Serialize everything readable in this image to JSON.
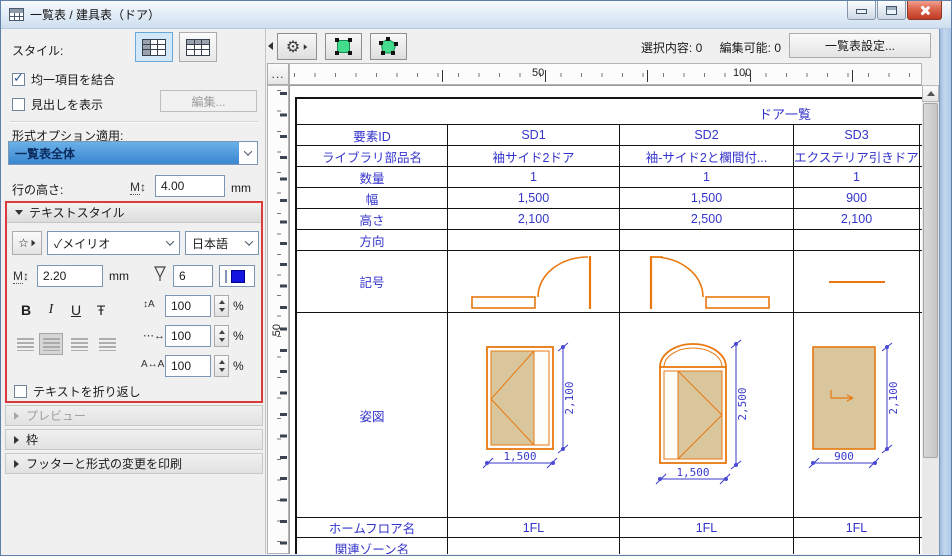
{
  "window": {
    "title": "一覧表 / 建具表（ドア）"
  },
  "colors": {
    "table_text_blue": "#3434CC",
    "drawing_orange": "#E8780F",
    "door_fill_tan": "#D9C69C",
    "dimension_blue": "#3A3ACC",
    "highlight_red": "#DC3A3A",
    "pen_color_swatch": "#1414E0",
    "selection_green": "#42DC8C"
  },
  "sidebar": {
    "style_label": "スタイル:",
    "merge_checkbox_label": "均一項目を結合",
    "headline_checkbox_label": "見出しを表示",
    "edit_button_label": "編集...",
    "format_option_label": "形式オプション適用:",
    "format_option_value": "一覧表全体",
    "row_height_label": "行の高さ:",
    "row_height_icon": "M",
    "row_height_value": "4.00",
    "row_height_unit": "mm",
    "text_style": {
      "header": "テキストスタイル",
      "font_check": "✓",
      "font_name": "メイリオ",
      "language": "日本語",
      "size_icon": "M",
      "size_value": "2.20",
      "size_unit": "mm",
      "pen_value": "6",
      "bold_label": "B",
      "italic_label": "I",
      "underline_label": "U",
      "strike_label": "Ŧ",
      "line_spacing_value": "100",
      "width_factor_value": "100",
      "char_spacing_value": "100",
      "percent": "%",
      "wrap_checkbox_label": "テキストを折り返し"
    },
    "sections": [
      {
        "label": "プレビュー"
      },
      {
        "label": "枠"
      },
      {
        "label": "フッターと形式の変更を印刷"
      }
    ]
  },
  "toolbar": {
    "selection_label": "選択内容:",
    "selection_count": "0",
    "editable_label": "編集可能:",
    "editable_count": "0",
    "settings_button": "一覧表設定..."
  },
  "ruler": {
    "corner_label": "...",
    "h_label_50": "50",
    "h_label_100": "100",
    "v_label_50": "50"
  },
  "table": {
    "title": "ドア一覧",
    "rows": [
      {
        "label": "要素ID",
        "values": [
          "SD1",
          "SD2",
          "SD3"
        ]
      },
      {
        "label": "ライブラリ部品名",
        "values": [
          "袖サイド2ドア",
          "袖-サイド2と欄間付...",
          "エクステリア引きドア"
        ]
      },
      {
        "label": "数量",
        "values": [
          "1",
          "1",
          "1"
        ]
      },
      {
        "label": "幅",
        "values": [
          "1,500",
          "1,500",
          "900"
        ]
      },
      {
        "label": "高さ",
        "values": [
          "2,100",
          "2,500",
          "2,100"
        ]
      },
      {
        "label": "方向",
        "values": [
          "",
          "",
          ""
        ]
      }
    ],
    "symbol_row_label": "記号",
    "elevation_row_label": "姿図",
    "dimensions": {
      "sd1": {
        "w": "1,500",
        "h": "2,100"
      },
      "sd2": {
        "w": "1,500",
        "h": "2,500"
      },
      "sd3": {
        "w": "900",
        "h": "2,100"
      }
    },
    "footer_rows": [
      {
        "label": "ホームフロア名",
        "values": [
          "1FL",
          "1FL",
          "1FL"
        ]
      },
      {
        "label": "関連ゾーン名",
        "values": [
          "",
          "",
          ""
        ]
      }
    ]
  }
}
